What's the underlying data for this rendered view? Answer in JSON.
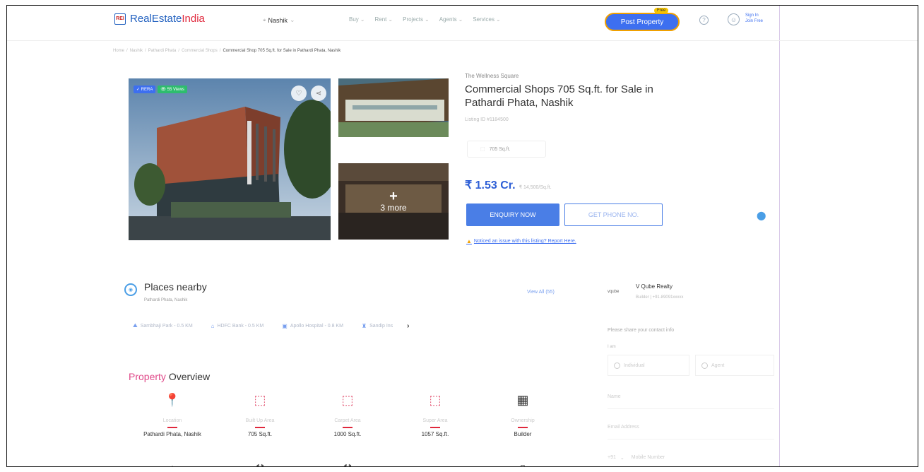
{
  "header": {
    "logo_text_a": "RealEstate",
    "logo_text_b": "India",
    "logo_mark": "REI",
    "city": "Nashik",
    "nav": [
      "Buy",
      "Rent",
      "Projects",
      "Agents",
      "Services"
    ],
    "post_property": "Post Property",
    "free_badge": "Free",
    "signin_line1": "Sign In",
    "signin_line2": "Join Free"
  },
  "breadcrumb": {
    "items": [
      "Home",
      "Nashik",
      "Pathardi Phata",
      "Commercial Shops"
    ],
    "current": "Commercial Shop 705 Sq.ft. for Sale in Pathardi Phata, Nashik"
  },
  "gallery": {
    "badge_rera": "RERA",
    "badge_views": "55 Views",
    "more_text": "3 more"
  },
  "listing": {
    "project_name": "The Wellness Square",
    "title": "Commercial Shops 705 Sq.ft. for Sale in Pathardi Phata, Nashik",
    "listing_id": "Listing ID #1184500",
    "area_chip": "705 Sq.ft.",
    "price": "₹ 1.53 Cr.",
    "price_per_sqft": "₹ 14,500/Sq.ft.",
    "enquiry_button": "ENQUIRY NOW",
    "phone_button": "GET PHONE NO.",
    "report_text": "Noticed an issue with this listing? Report Here."
  },
  "places": {
    "title": "Places nearby",
    "subtitle": "Pathardi Phata, Nashik",
    "view_all": "View All (55)",
    "items": [
      {
        "name": "Sambhaji Park - 0.5 KM",
        "icon": "park-icon"
      },
      {
        "name": "HDFC Bank - 0.5 KM",
        "icon": "bank-icon"
      },
      {
        "name": "Apollo Hospital - 0.8 KM",
        "icon": "hospital-icon"
      },
      {
        "name": "Sandip Ins",
        "icon": "school-icon"
      }
    ]
  },
  "overview": {
    "title_a": "Property",
    "title_b": "Overview",
    "items": [
      {
        "label": "Location",
        "value": "Pathardi Phata, Nashik",
        "icon": "location-icon"
      },
      {
        "label": "Built Up Area",
        "value": "705 Sq.ft.",
        "icon": "area-icon"
      },
      {
        "label": "Carpet Area",
        "value": "1000 Sq.ft.",
        "icon": "area-icon"
      },
      {
        "label": "Super Area",
        "value": "1057 Sq.ft.",
        "icon": "area-icon"
      },
      {
        "label": "Ownership",
        "value": "Builder",
        "icon": "building-icon"
      }
    ]
  },
  "contact": {
    "agent_name": "V Qube Realty",
    "agent_sub": "Builder | +91-89091xxxxx",
    "agent_logo": "vqube",
    "share_title": "Please share your contact info",
    "iam": "I am",
    "option_individual": "Individual",
    "option_agent": "Agent",
    "name_placeholder": "Name",
    "email_placeholder": "Email Address",
    "country_code": "+91",
    "mobile_placeholder": "Mobile Number"
  },
  "colors": {
    "brand_blue": "#1f5fbf",
    "brand_red": "#e0283c",
    "accent_blue": "#3d6ff0"
  }
}
